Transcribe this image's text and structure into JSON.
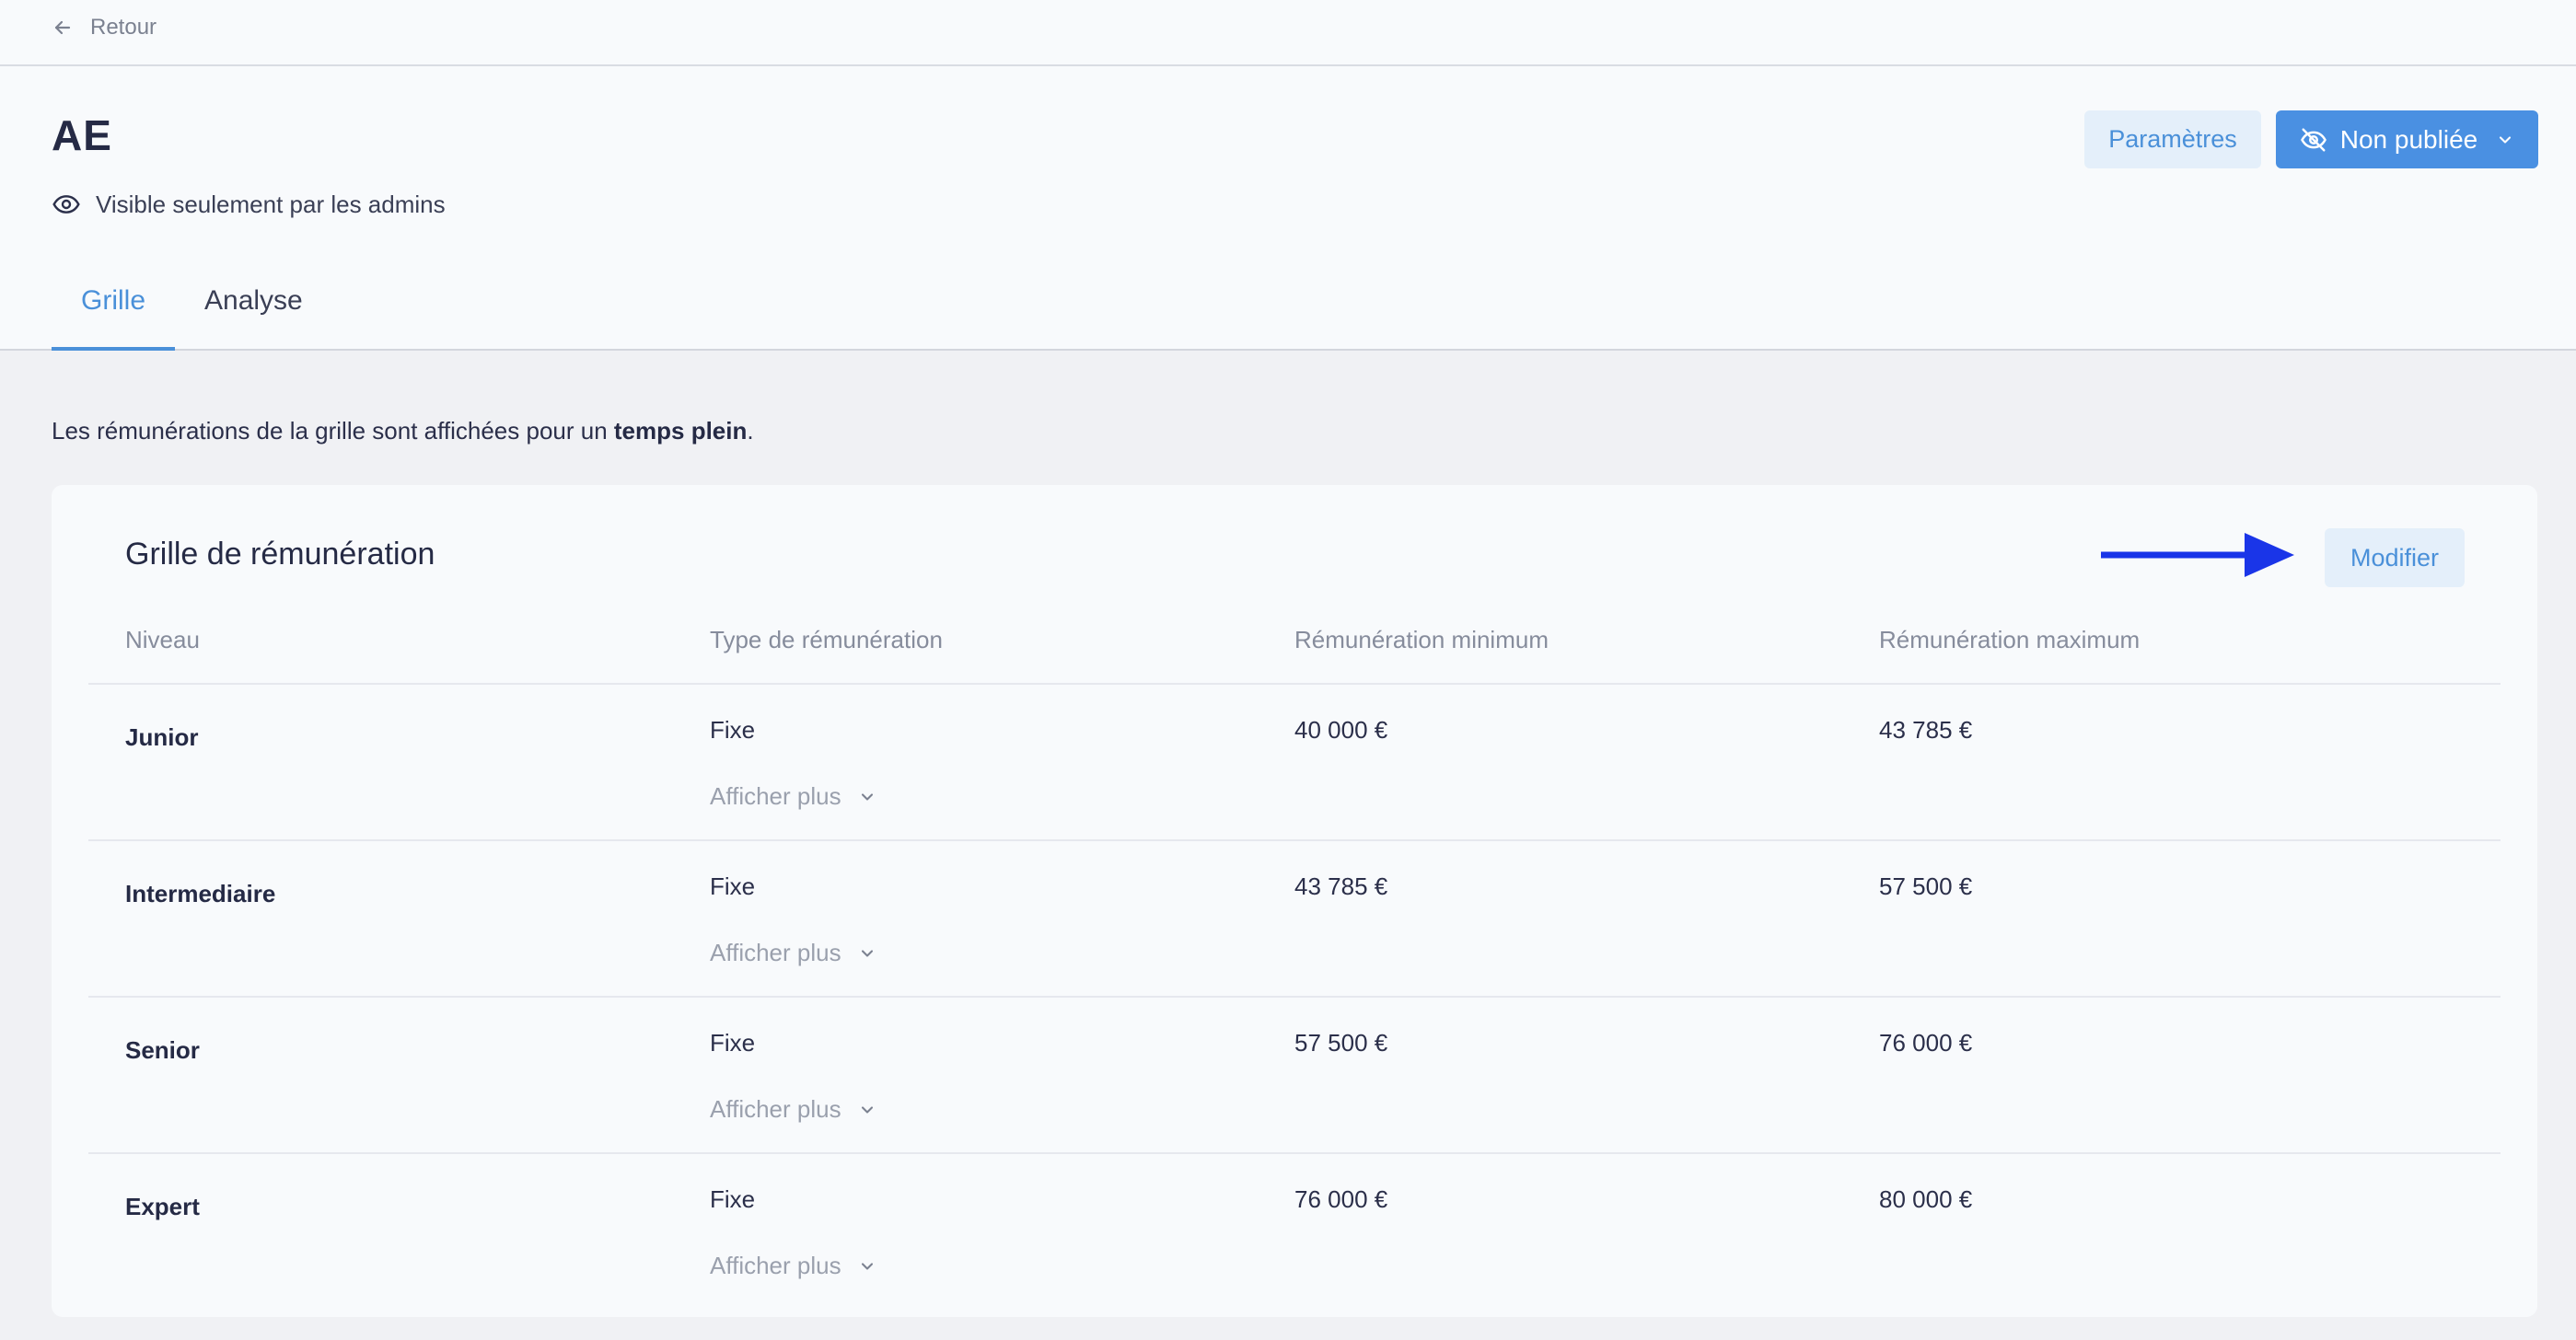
{
  "topbar": {
    "back_label": "Retour"
  },
  "header": {
    "title": "AE",
    "visibility_text": "Visible seulement par les admins",
    "params_label": "Paramètres",
    "publish_label": "Non publiée"
  },
  "tabs": [
    {
      "label": "Grille",
      "active": true
    },
    {
      "label": "Analyse",
      "active": false
    }
  ],
  "note": {
    "prefix": "Les rémunérations de la grille sont affichées pour un ",
    "bold": "temps plein",
    "suffix": "."
  },
  "grid": {
    "title": "Grille de rémunération",
    "modify_label": "Modifier",
    "arrow_color": "#1a35e8",
    "columns": [
      "Niveau",
      "Type de rémunération",
      "Rémunération minimum",
      "Rémunération maximum"
    ],
    "rows": [
      {
        "level": "Junior",
        "type": "Fixe",
        "min": "40 000 €",
        "max": "43 785 €",
        "more": "Afficher plus"
      },
      {
        "level": "Intermediaire",
        "type": "Fixe",
        "min": "43 785 €",
        "max": "57 500 €",
        "more": "Afficher plus"
      },
      {
        "level": "Senior",
        "type": "Fixe",
        "min": "57 500 €",
        "max": "76 000 €",
        "more": "Afficher plus"
      },
      {
        "level": "Expert",
        "type": "Fixe",
        "min": "76 000 €",
        "max": "80 000 €",
        "more": "Afficher plus"
      }
    ]
  },
  "colors": {
    "accent": "#4a90d9",
    "accent_bg": "#e4effa",
    "primary_button": "#4a90e2"
  }
}
